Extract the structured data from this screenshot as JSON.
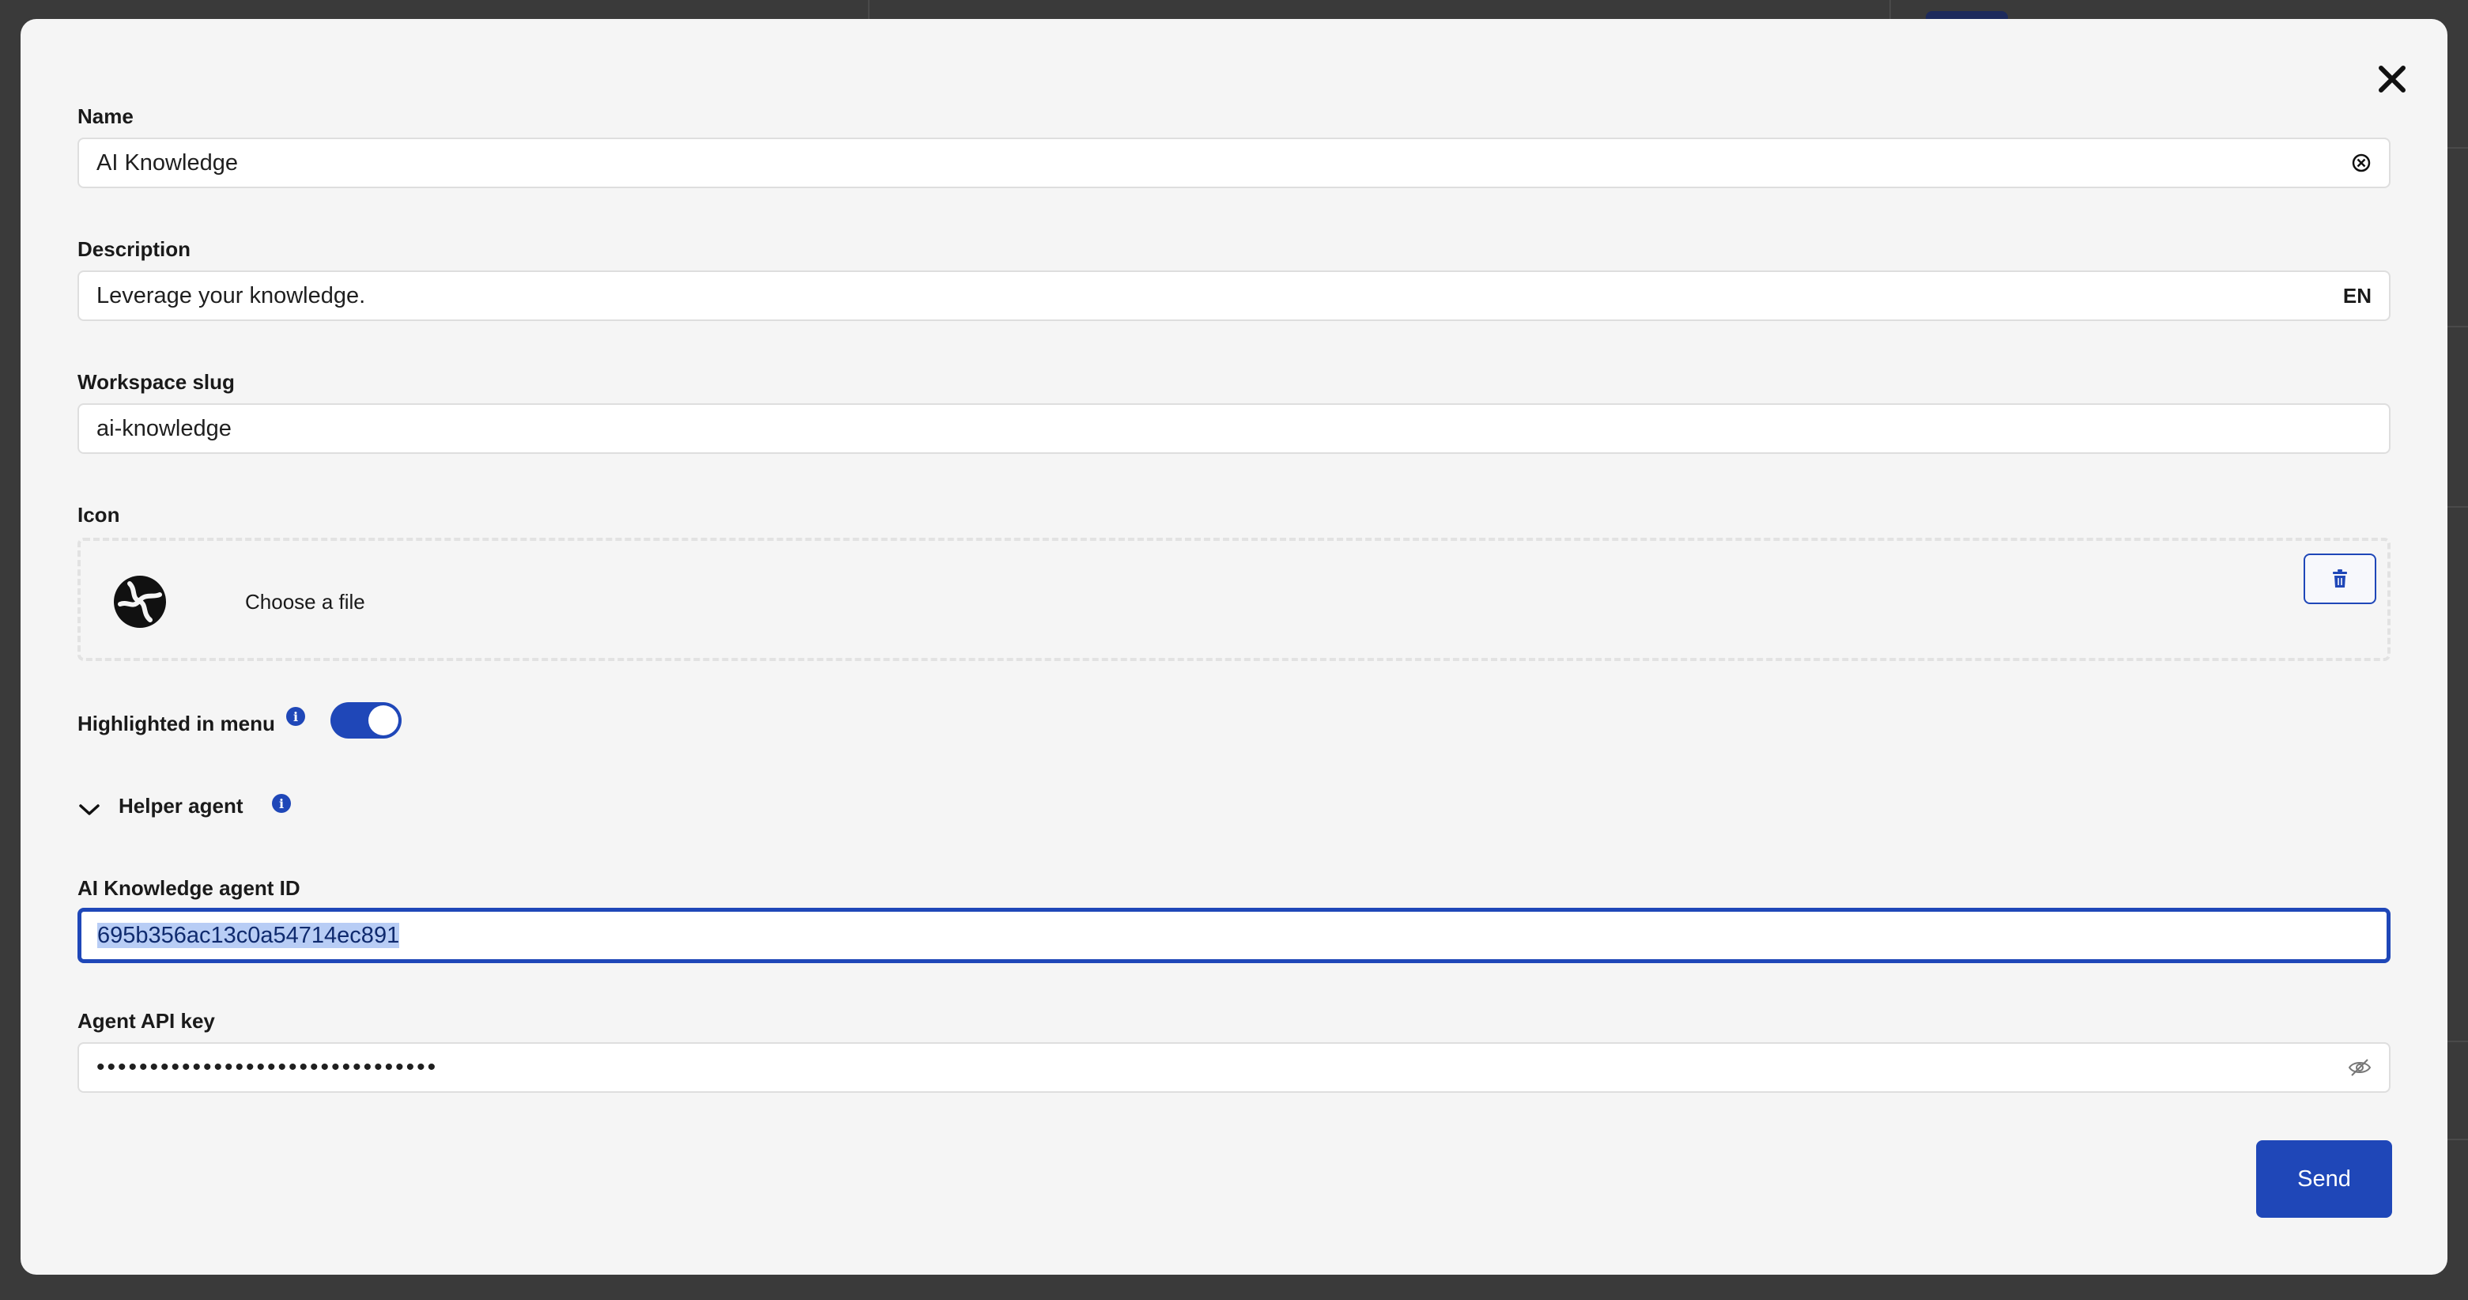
{
  "form": {
    "name": {
      "label": "Name",
      "value": "AI Knowledge"
    },
    "description": {
      "label": "Description",
      "value": "Leverage your knowledge.",
      "language": "EN"
    },
    "workspace_slug": {
      "label": "Workspace slug",
      "value": "ai-knowledge"
    },
    "icon": {
      "label": "Icon",
      "choose_file": "Choose a file"
    },
    "highlighted": {
      "label": "Highlighted in menu",
      "enabled": true
    },
    "helper_agent": {
      "label": "Helper agent",
      "expanded": true
    },
    "agent_id": {
      "label": "AI Knowledge agent ID",
      "value": "695b356ac13c0a54714ec891"
    },
    "api_key": {
      "label": "Agent API key",
      "masked_value": "••••••••••••••••••••••••••••••••"
    },
    "send_label": "Send"
  },
  "icons": {
    "close": "close-icon",
    "clear": "clear-input-icon",
    "trash": "trash-icon",
    "info": "info-icon",
    "chevron": "chevron-down-icon",
    "eye": "eye-slash-icon",
    "logo": "brain-logo-icon"
  },
  "colors": {
    "accent": "#1f47b8",
    "modal_bg": "#f5f5f5",
    "overlay": "#343434",
    "selection": "#b8cdf5"
  }
}
